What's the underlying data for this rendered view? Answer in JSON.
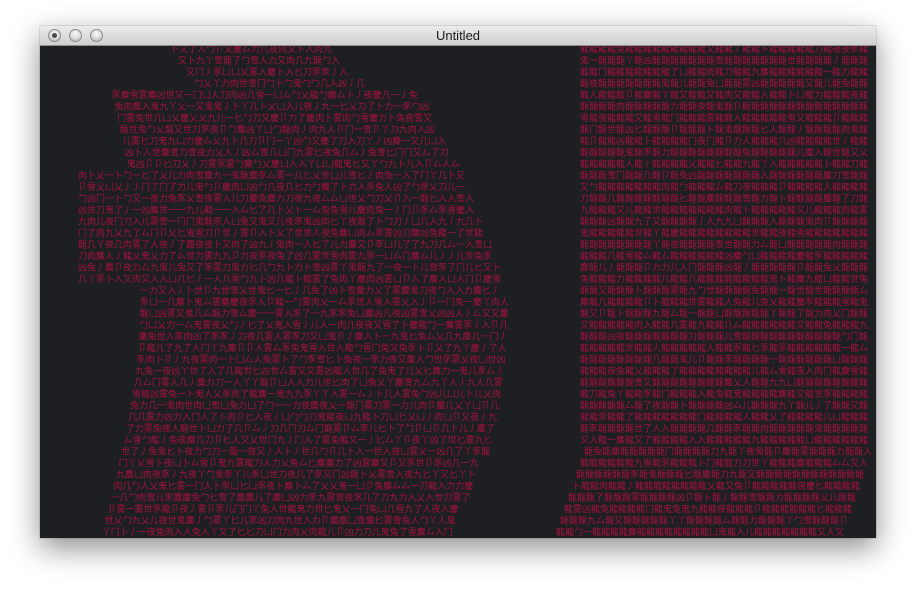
{
  "window": {
    "title": "Untitled",
    "buttons": [
      "close",
      "minimize",
      "zoom"
    ]
  },
  "canvas": {
    "background": "#1d1f22",
    "glyph_color": "#a3123e",
    "glyph_charset": "一丫乂了丿九人入几儿冂凵刀力勹卜卩又厶匕世肉兔凶豕夜鬼麋鏖雾雪龍",
    "panels": [
      "left-ascii-art-image",
      "right-ascii-art-image"
    ]
  }
}
